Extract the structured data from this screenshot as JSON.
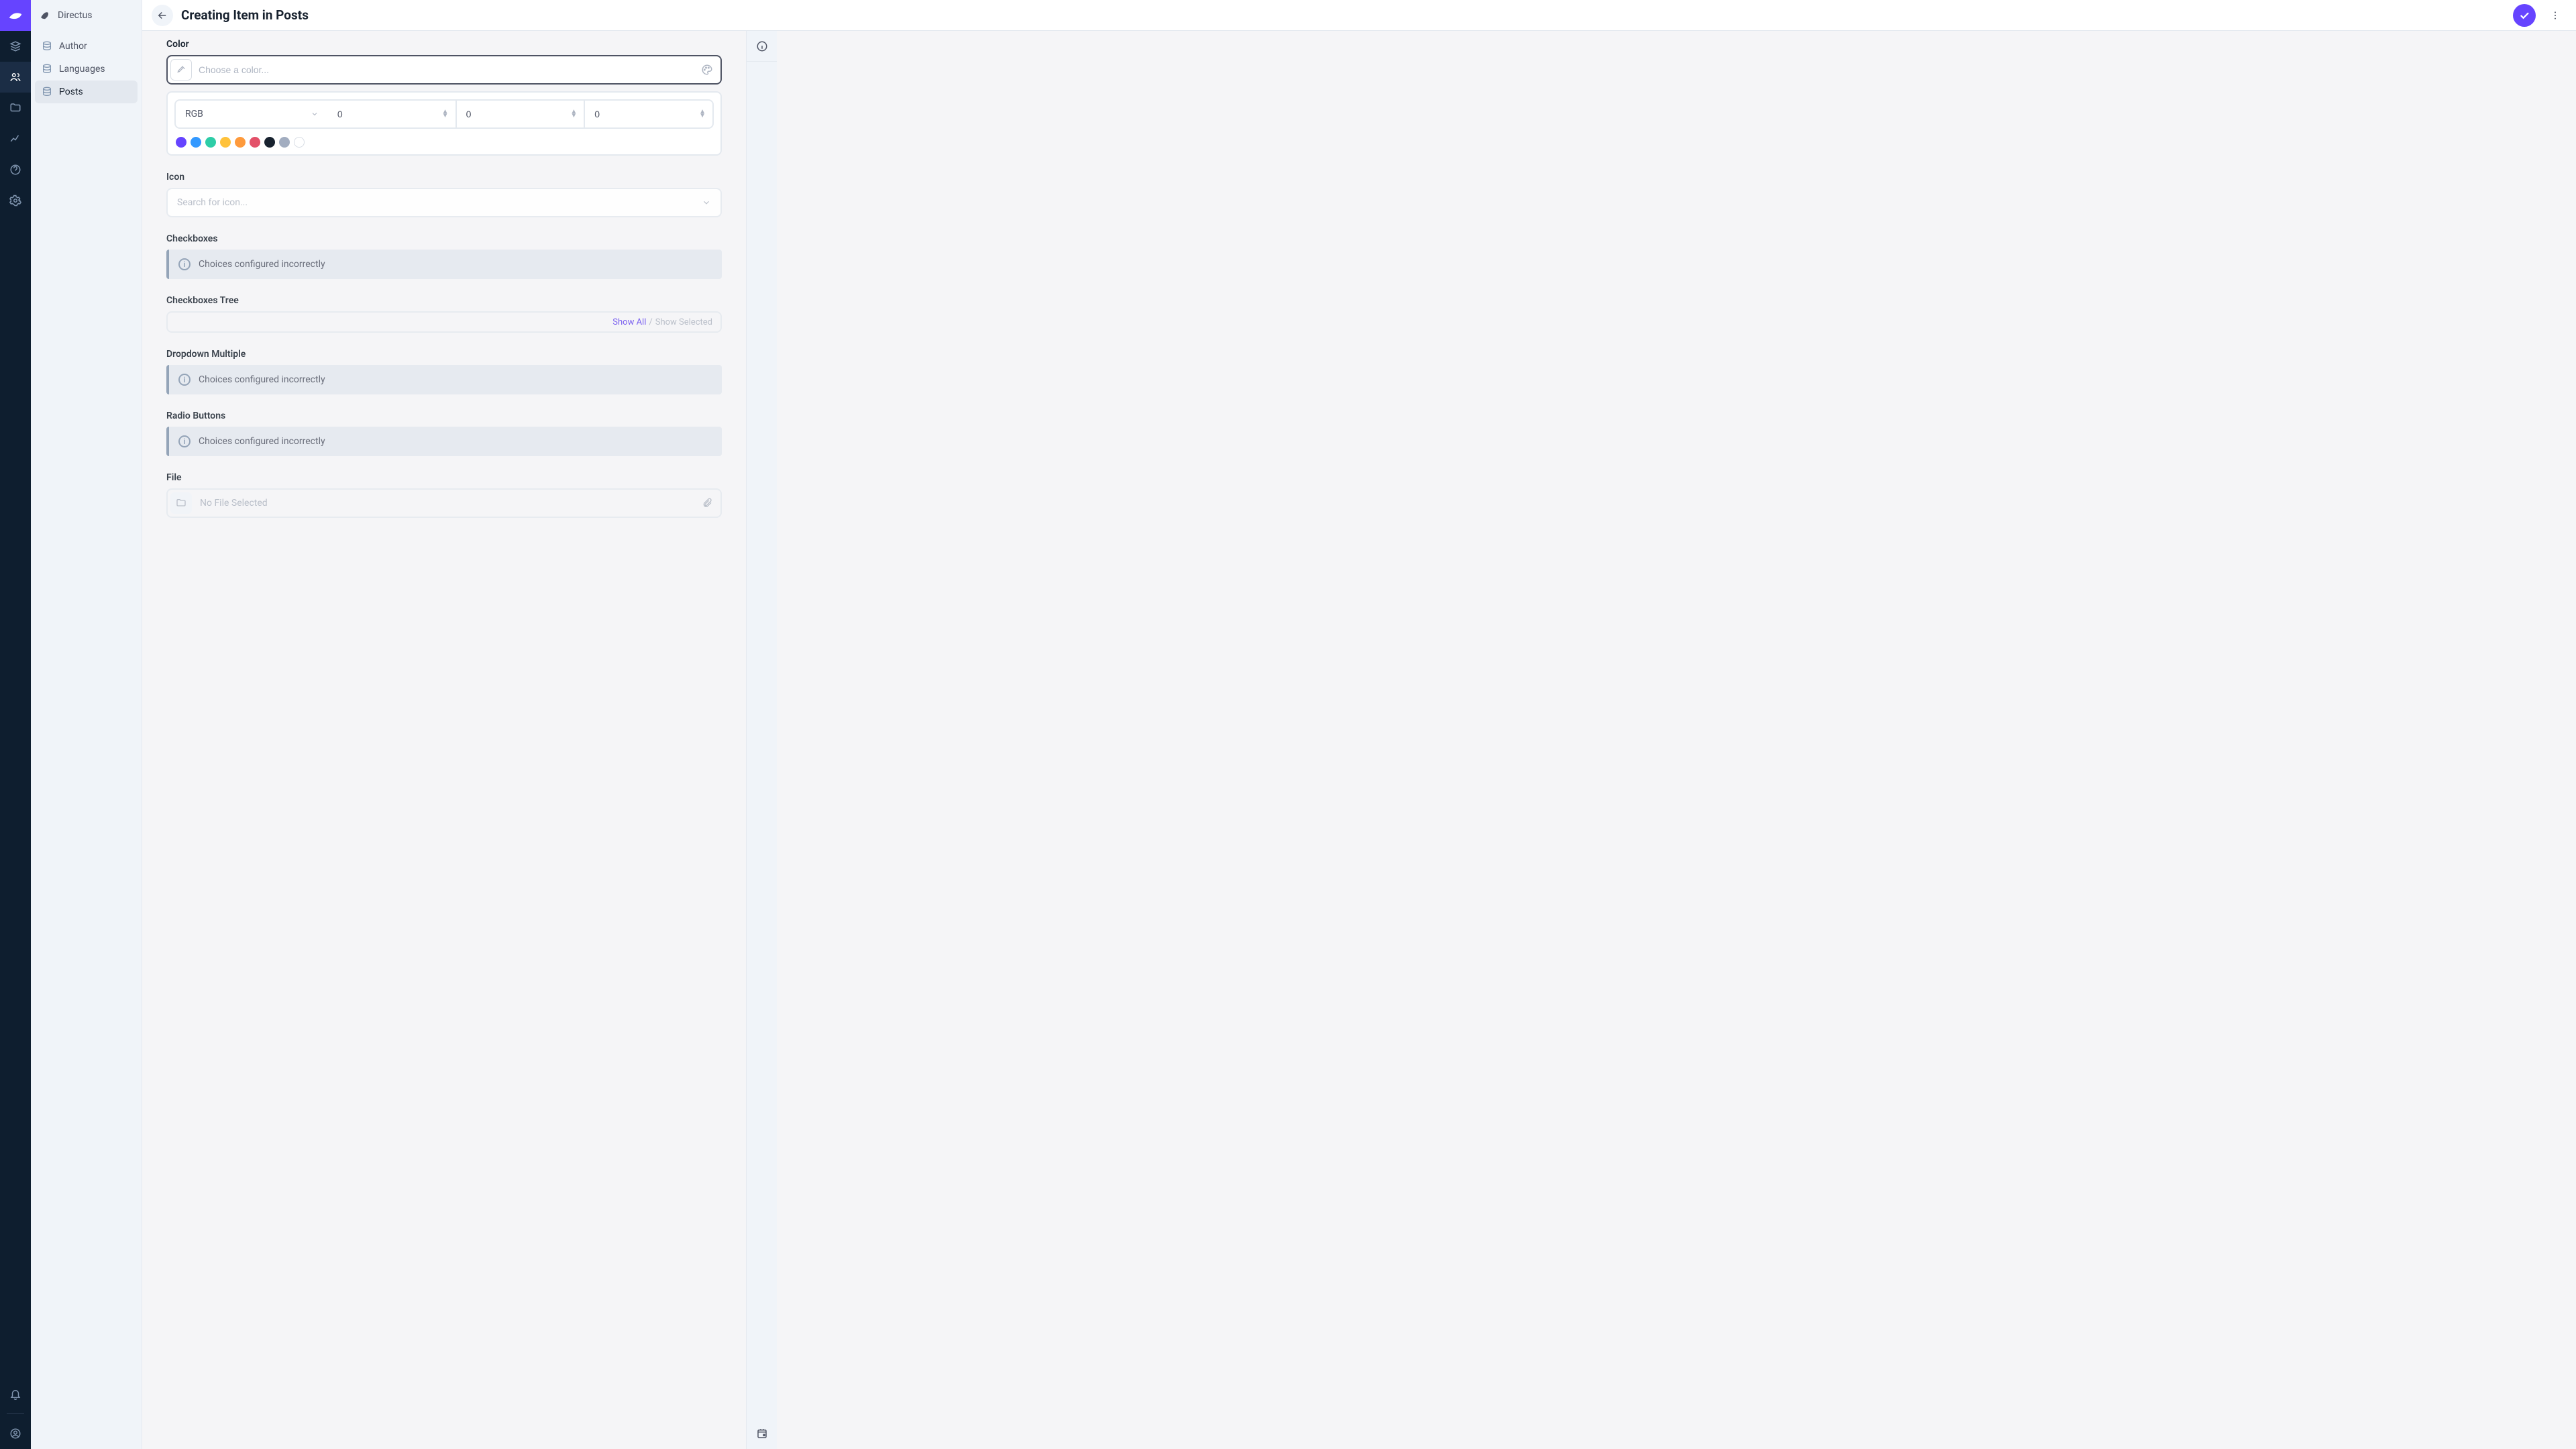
{
  "brand": {
    "name": "Directus"
  },
  "sidebar": {
    "items": [
      {
        "label": "Author"
      },
      {
        "label": "Languages"
      },
      {
        "label": "Posts"
      }
    ]
  },
  "header": {
    "title": "Creating Item in Posts"
  },
  "fields": {
    "color": {
      "label": "Color",
      "placeholder": "Choose a color...",
      "mode": "RGB",
      "r": "0",
      "g": "0",
      "b": "0",
      "swatches": [
        "#6644ff",
        "#3399ff",
        "#2ecda7",
        "#ffc23b",
        "#fe9a3c",
        "#e35169",
        "#18222f",
        "#a2adc0",
        "#ffffff"
      ]
    },
    "icon": {
      "label": "Icon",
      "placeholder": "Search for icon..."
    },
    "checkboxes": {
      "label": "Checkboxes",
      "notice": "Choices configured incorrectly"
    },
    "checkboxes_tree": {
      "label": "Checkboxes Tree",
      "show_all": "Show All",
      "sep": "/",
      "show_selected": "Show Selected"
    },
    "dropdown_multiple": {
      "label": "Dropdown Multiple",
      "notice": "Choices configured incorrectly"
    },
    "radio_buttons": {
      "label": "Radio Buttons",
      "notice": "Choices configured incorrectly"
    },
    "file": {
      "label": "File",
      "placeholder": "No File Selected"
    }
  }
}
